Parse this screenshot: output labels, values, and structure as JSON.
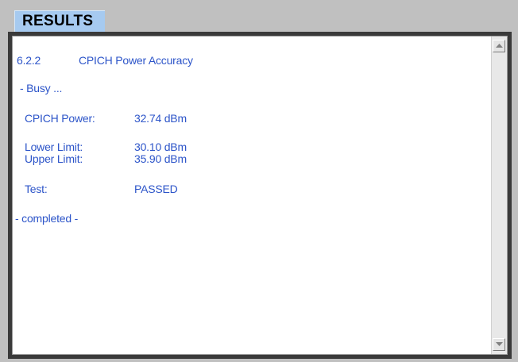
{
  "header": {
    "title": "RESULTS"
  },
  "results": {
    "test_number": "6.2.2",
    "test_name": "CPICH Power Accuracy",
    "busy": "- Busy ...",
    "cpich_power_label": "CPICH Power:",
    "cpich_power_value": "32.74 dBm",
    "lower_limit_label": "Lower Limit:",
    "lower_limit_value": "30.10 dBm",
    "upper_limit_label": "Upper Limit:",
    "upper_limit_value": "35.90 dBm",
    "test_label": "Test:",
    "test_value": "PASSED",
    "completed": "- completed -"
  },
  "colors": {
    "text": "#2d55c9",
    "tab_background": "#a6caf0",
    "window_background": "#c0c0c0"
  },
  "icons": [
    "scroll-up-arrow-icon",
    "scroll-down-arrow-icon"
  ]
}
